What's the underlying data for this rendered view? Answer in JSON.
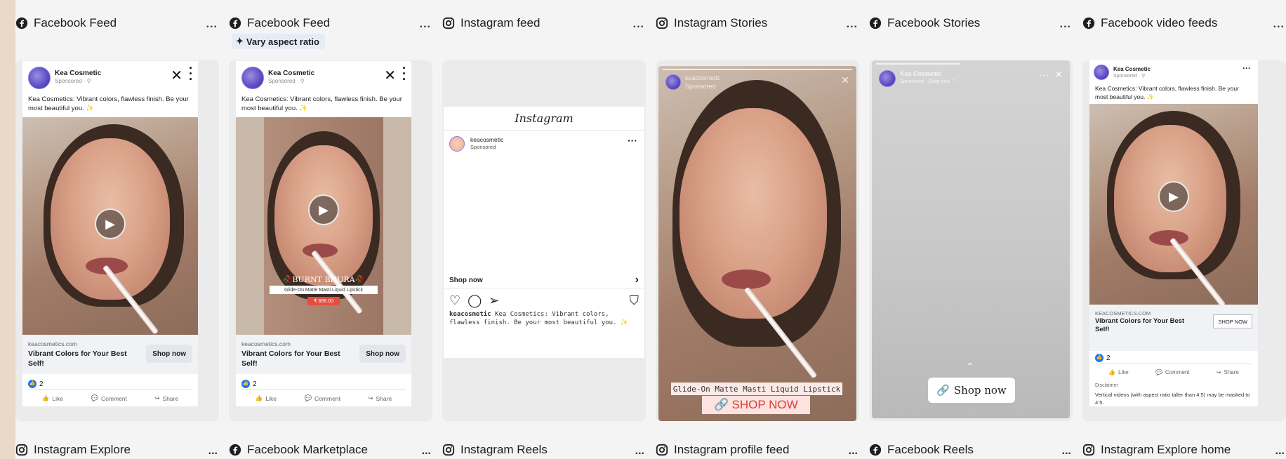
{
  "placements": [
    {
      "platform": "facebook",
      "title": "Facebook Feed"
    },
    {
      "platform": "facebook",
      "title": "Facebook Feed",
      "badge": "Vary aspect ratio"
    },
    {
      "platform": "instagram",
      "title": "Instagram feed"
    },
    {
      "platform": "instagram",
      "title": "Instagram Stories"
    },
    {
      "platform": "facebook",
      "title": "Facebook Stories"
    },
    {
      "platform": "facebook",
      "title": "Facebook video feeds"
    }
  ],
  "bottom_placements": [
    {
      "platform": "instagram",
      "title": "Instagram Explore"
    },
    {
      "platform": "facebook",
      "title": "Facebook Marketplace"
    },
    {
      "platform": "instagram",
      "title": "Instagram Reels"
    },
    {
      "platform": "instagram",
      "title": "Instagram profile feed"
    },
    {
      "platform": "facebook",
      "title": "Facebook Reels"
    },
    {
      "platform": "instagram",
      "title": "Instagram Explore home"
    }
  ],
  "more_label": "...",
  "ad": {
    "page_name": "Kea Cosmetic",
    "sponsored": "Sponsored · ⚲",
    "primary_text": "Kea Cosmetics: Vibrant colors, flawless finish. Be your most beautiful you. ✨",
    "domain": "keacosmetics.com",
    "domain_upper": "KEACOSMETICS.COM",
    "headline": "Vibrant Colors for Your Best Self!",
    "cta": "Shop now",
    "cta_upper": "SHOP NOW",
    "reactions": "2",
    "like": "Like",
    "comment": "Comment",
    "share": "Share"
  },
  "overlay": {
    "burnt": "🥀BURNT BHURA🥀",
    "product": "Glide-On Matte Masti Liquid Lipstick",
    "price": "₹ 699.00"
  },
  "instagram": {
    "logo": "Instagram",
    "handle": "keacosmetic",
    "sponsored": "Sponsored",
    "shop_now": "Shop now",
    "caption_handle": "keacosmetic",
    "caption": "Kea Cosmetics: Vibrant colors, flawless finish. Be your most beautiful you. ✨"
  },
  "ig_story": {
    "handle": "keacosmetic",
    "sponsored": "Sponsored",
    "product": "Glide-On Matte Masti Liquid Lipstick",
    "cta": "SHOP NOW"
  },
  "fb_story": {
    "page_name": "Kea Cosmetic",
    "sub": "Sponsored · Shop now ⌃",
    "cta": "Shop now"
  },
  "video_feed": {
    "disclaimer_title": "Disclaimer",
    "disclaimer": "Vertical videos (with aspect ratio taller than 4:5) may be masked to 4:5."
  },
  "colors": {
    "facebook_blue": "#1877f2",
    "shop_red": "#e03c3c",
    "badge_bg": "#e6ecf7"
  }
}
